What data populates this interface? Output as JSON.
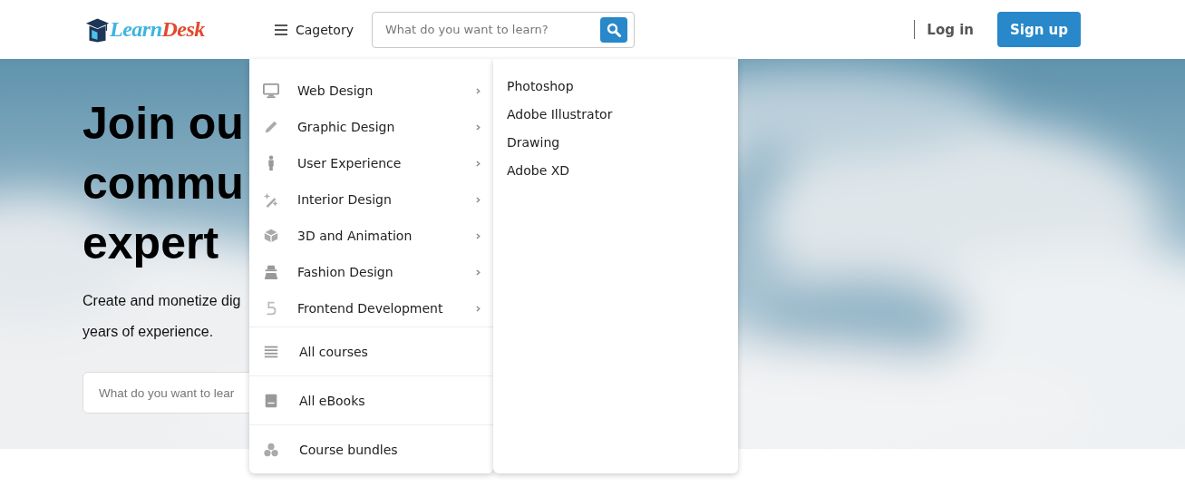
{
  "header": {
    "logo": {
      "first": "Learn",
      "second": "Desk"
    },
    "category_button": "Cagetory",
    "search": {
      "placeholder": "What do you want to learn?"
    },
    "login": "Log in",
    "signup": "Sign up"
  },
  "hero": {
    "title_lines": [
      "Join ou",
      "commu",
      "expert"
    ],
    "subtitle_lines": [
      "Create and monetize dig",
      "years of experience."
    ],
    "search": {
      "placeholder": "What do you want to lear"
    }
  },
  "menu": {
    "categories": [
      {
        "label": "Web Design",
        "kind": "submenu"
      },
      {
        "label": "Graphic Design",
        "kind": "submenu"
      },
      {
        "label": "User Experience",
        "kind": "submenu"
      },
      {
        "label": "Interior Design",
        "kind": "submenu"
      },
      {
        "label": "3D and Animation",
        "kind": "submenu"
      },
      {
        "label": "Fashion Design",
        "kind": "submenu"
      },
      {
        "label": "Frontend Development",
        "kind": "submenu"
      },
      {
        "label": "All courses",
        "kind": "link"
      },
      {
        "label": "All eBooks",
        "kind": "link"
      },
      {
        "label": "Course bundles",
        "kind": "link"
      }
    ],
    "subitems": [
      "Photoshop",
      "Adobe Illustrator",
      "Drawing",
      "Adobe XD"
    ]
  }
}
